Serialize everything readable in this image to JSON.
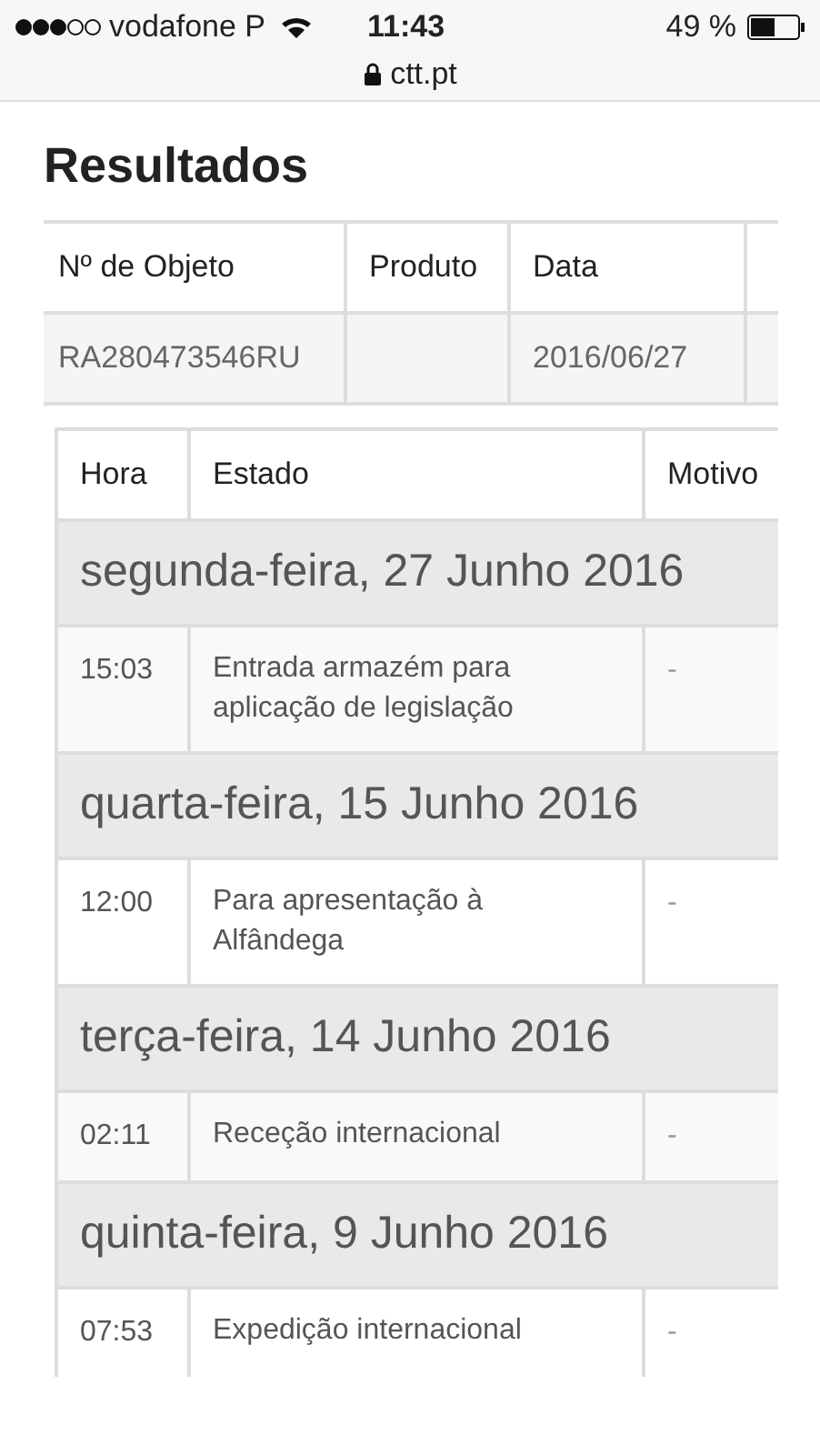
{
  "status_bar": {
    "carrier": "vodafone P",
    "time": "11:43",
    "battery": "49 %"
  },
  "address_bar": {
    "url": "ctt.pt"
  },
  "title": "Resultados",
  "summary_table": {
    "columns": [
      "Nº de Objeto",
      "Produto",
      "Data"
    ],
    "rows": [
      {
        "object_number": "RA280473546RU",
        "date": "2016/06/27"
      }
    ]
  },
  "events_table": {
    "columns": [
      "Hora",
      "Estado",
      "Motivo"
    ],
    "groups": [
      {
        "date": "segunda-feira, 27 Junho 2016",
        "events": [
          {
            "time": "15:03",
            "status": "Entrada armazém para aplicação de legislação",
            "reason": "-"
          }
        ]
      },
      {
        "date": "quarta-feira, 15 Junho 2016",
        "events": [
          {
            "time": "12:00",
            "status": "Para apresentação à Alfândega",
            "reason": "-"
          }
        ]
      },
      {
        "date": "terça-feira, 14 Junho 2016",
        "events": [
          {
            "time": "02:11",
            "status": "Receção internacional",
            "reason": "-"
          }
        ]
      },
      {
        "date": "quinta-feira, 9 Junho 2016",
        "events": [
          {
            "time": "07:53",
            "status": "Expedição internacional",
            "reason": "-"
          }
        ]
      }
    ]
  }
}
